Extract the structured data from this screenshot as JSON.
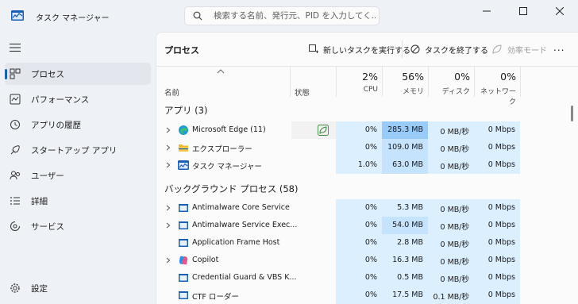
{
  "window": {
    "title": "タスク マネージャー",
    "search_placeholder": "検索する名前、発行元、PID を入力してく...",
    "controls": [
      "minimize-icon",
      "maximize-icon",
      "close-icon"
    ]
  },
  "sidebar": {
    "items": [
      {
        "label": "プロセス",
        "icon": "processes-icon",
        "active": true
      },
      {
        "label": "パフォーマンス",
        "icon": "performance-icon",
        "active": false
      },
      {
        "label": "アプリの履歴",
        "icon": "app-history-icon",
        "active": false
      },
      {
        "label": "スタートアップ アプリ",
        "icon": "startup-icon",
        "active": false
      },
      {
        "label": "ユーザー",
        "icon": "users-icon",
        "active": false
      },
      {
        "label": "詳細",
        "icon": "details-icon",
        "active": false
      },
      {
        "label": "サービス",
        "icon": "services-icon",
        "active": false
      }
    ],
    "settings_label": "設定"
  },
  "toolbar": {
    "page_title": "プロセス",
    "new_task": "新しいタスクを実行する",
    "end_task": "タスクを終了する",
    "efficiency_mode": "効率モード",
    "more": "..."
  },
  "columns": {
    "name": "名前",
    "status": "状態",
    "cpu": {
      "pct": "2%",
      "label": "CPU"
    },
    "memory": {
      "pct": "56%",
      "label": "メモリ"
    },
    "disk": {
      "pct": "0%",
      "label": "ディスク"
    },
    "network": {
      "pct": "0%",
      "label": "ネットワーク"
    }
  },
  "sections": {
    "apps": "アプリ (3)",
    "background": "バックグラウンド プロセス (58)"
  },
  "apps": [
    {
      "name": "Microsoft Edge (11)",
      "icon": "edge-icon",
      "cpu": "0%",
      "memory": "285.3 MB",
      "disk": "0 MB/秒",
      "network": "0 Mbps",
      "expandable": true,
      "status_icon": "efficiency-leaf-icon"
    },
    {
      "name": "エクスプローラー",
      "icon": "folder-icon",
      "cpu": "0%",
      "memory": "109.0 MB",
      "disk": "0 MB/秒",
      "network": "0 Mbps",
      "expandable": true
    },
    {
      "name": "タスク マネージャー",
      "icon": "task-manager-icon",
      "cpu": "1.0%",
      "memory": "63.0 MB",
      "disk": "0 MB/秒",
      "network": "0 Mbps",
      "expandable": true
    }
  ],
  "background": [
    {
      "name": "Antimalware Core Service",
      "icon": "service-icon",
      "cpu": "0%",
      "memory": "5.3 MB",
      "disk": "0 MB/秒",
      "network": "0 Mbps",
      "expandable": true
    },
    {
      "name": "Antimalware Service Exec...",
      "icon": "service-icon",
      "cpu": "0%",
      "memory": "54.0 MB",
      "disk": "0 MB/秒",
      "network": "0 Mbps",
      "expandable": true
    },
    {
      "name": "Application Frame Host",
      "icon": "service-icon",
      "cpu": "0%",
      "memory": "2.8 MB",
      "disk": "0 MB/秒",
      "network": "0 Mbps",
      "expandable": false
    },
    {
      "name": "Copilot",
      "icon": "copilot-icon",
      "cpu": "0%",
      "memory": "16.3 MB",
      "disk": "0 MB/秒",
      "network": "0 Mbps",
      "expandable": true
    },
    {
      "name": "Credential Guard & VBS K...",
      "icon": "service-icon",
      "cpu": "0%",
      "memory": "0.5 MB",
      "disk": "0 MB/秒",
      "network": "0 Mbps",
      "expandable": false
    },
    {
      "name": "CTF ローダー",
      "icon": "service-icon",
      "cpu": "0%",
      "memory": "17.5 MB",
      "disk": "0.1 MB/秒",
      "network": "0 Mbps",
      "expandable": false
    }
  ],
  "colors": {
    "heat_low": "#dcefff",
    "heat_mid": "#c5e3fd",
    "heat_high": "#99cbf8",
    "accent": "#1a5fb4"
  }
}
